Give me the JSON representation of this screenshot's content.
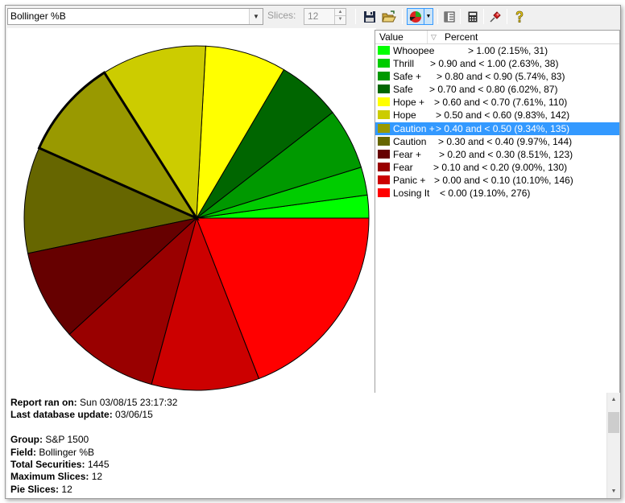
{
  "toolbar": {
    "field_select_value": "Bollinger %B",
    "slices_label": "Slices:",
    "slices_value": "12",
    "icons": [
      "save-icon",
      "open-folder-icon",
      "pie-chart-icon",
      "report-view-icon",
      "calculator-icon",
      "pin-icon",
      "help-icon"
    ]
  },
  "legend": {
    "header_value": "Value",
    "header_percent": "Percent",
    "selected_index": 6,
    "items": [
      {
        "name": "Whoopee",
        "range": "> 1.00 (2.15%, 31)",
        "color": "#00ff00"
      },
      {
        "name": "Thrill",
        "range": "> 0.90 and < 1.00 (2.63%, 38)",
        "color": "#00cc00"
      },
      {
        "name": "Safe +",
        "range": "> 0.80 and < 0.90 (5.74%, 83)",
        "color": "#009900"
      },
      {
        "name": "Safe",
        "range": "> 0.70 and < 0.80 (6.02%, 87)",
        "color": "#006600"
      },
      {
        "name": "Hope +",
        "range": "> 0.60 and < 0.70 (7.61%, 110)",
        "color": "#ffff00"
      },
      {
        "name": "Hope",
        "range": "> 0.50 and < 0.60 (9.83%, 142)",
        "color": "#cccc00"
      },
      {
        "name": "Caution +",
        "range": "> 0.40 and < 0.50 (9.34%, 135)",
        "color": "#999900"
      },
      {
        "name": "Caution",
        "range": "> 0.30 and < 0.40 (9.97%, 144)",
        "color": "#666600"
      },
      {
        "name": "Fear +",
        "range": "> 0.20 and < 0.30 (8.51%, 123)",
        "color": "#660000"
      },
      {
        "name": "Fear",
        "range": "> 0.10 and < 0.20 (9.00%, 130)",
        "color": "#990000"
      },
      {
        "name": "Panic +",
        "range": "> 0.00 and < 0.10 (10.10%, 146)",
        "color": "#cc0000"
      },
      {
        "name": "Losing It",
        "range": "< 0.00 (19.10%, 276)",
        "color": "#ff0000"
      }
    ]
  },
  "chart_data": {
    "type": "pie",
    "categories": [
      "Whoopee",
      "Thrill",
      "Safe +",
      "Safe",
      "Hope +",
      "Hope",
      "Caution +",
      "Caution",
      "Fear +",
      "Fear",
      "Panic +",
      "Losing It"
    ],
    "values": [
      31,
      38,
      83,
      87,
      110,
      142,
      135,
      144,
      123,
      130,
      146,
      276
    ],
    "percents": [
      2.15,
      2.63,
      5.74,
      6.02,
      7.61,
      9.83,
      9.34,
      9.97,
      8.51,
      9.0,
      10.1,
      19.1
    ],
    "colors": [
      "#00ff00",
      "#00cc00",
      "#009900",
      "#006600",
      "#ffff00",
      "#cccc00",
      "#999900",
      "#666600",
      "#660000",
      "#990000",
      "#cc0000",
      "#ff0000"
    ],
    "highlighted": "Caution +",
    "start": "3 o'clock",
    "direction": "counterclockwise",
    "legend_placement": "right"
  },
  "report": {
    "ran_label": "Report ran on:",
    "ran_value": "Sun 03/08/15 23:17:32",
    "update_label": "Last database update:",
    "update_value": "03/06/15",
    "group_label": "Group:",
    "group_value": "S&P 1500",
    "field_label": "Field:",
    "field_value": "Bollinger %B",
    "total_label": "Total Securities:",
    "total_value": "1445",
    "max_label": "Maximum Slices:",
    "max_value": "12",
    "pie_label": "Pie Slices:",
    "pie_value": "12"
  }
}
